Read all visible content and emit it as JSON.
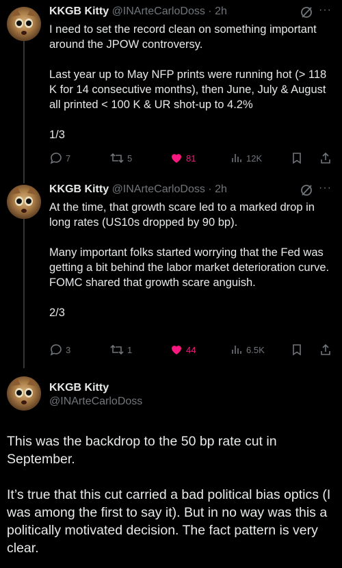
{
  "tweets": [
    {
      "name": "KKGB Kitty",
      "handle": "@INArteCarloDoss",
      "time": "2h",
      "paragraphs": [
        "I need to set the record clean on something important around the JPOW controversy.",
        "Last year up to May NFP prints were running hot (> 118 K for 14 consecutive months), then June, July & August all printed < 100 K & UR shot-up to 4.2%",
        "1/3"
      ],
      "replies": "7",
      "reposts": "5",
      "likes": "81",
      "views": "12K"
    },
    {
      "name": "KKGB Kitty",
      "handle": "@INArteCarloDoss",
      "time": "2h",
      "paragraphs": [
        "At the time, that growth scare led to a marked drop in long rates (US10s dropped by 90 bp).",
        "Many important folks started worrying that the Fed was getting a bit behind the labor market deterioration curve. FOMC shared that growth scare anguish.",
        "2/3"
      ],
      "replies": "3",
      "reposts": "1",
      "likes": "44",
      "views": "6.5K"
    }
  ],
  "main": {
    "name": "KKGB Kitty",
    "handle": "@INArteCarloDoss",
    "paragraphs": [
      "This was the backdrop to the 50 bp rate cut in September.",
      "It’s true that this cut carried a bad political bias optics (I was among the first to say it). But in no way was this a politically motivated decision. The fact pattern is very clear."
    ]
  },
  "colors": {
    "like": "#f91880",
    "muted": "#71767b",
    "text": "#e7e9ea",
    "bg": "#000000"
  },
  "icons": [
    "reply-icon",
    "repost-icon",
    "heart-icon",
    "views-icon",
    "bookmark-icon",
    "share-icon",
    "grok-icon",
    "more-icon"
  ]
}
